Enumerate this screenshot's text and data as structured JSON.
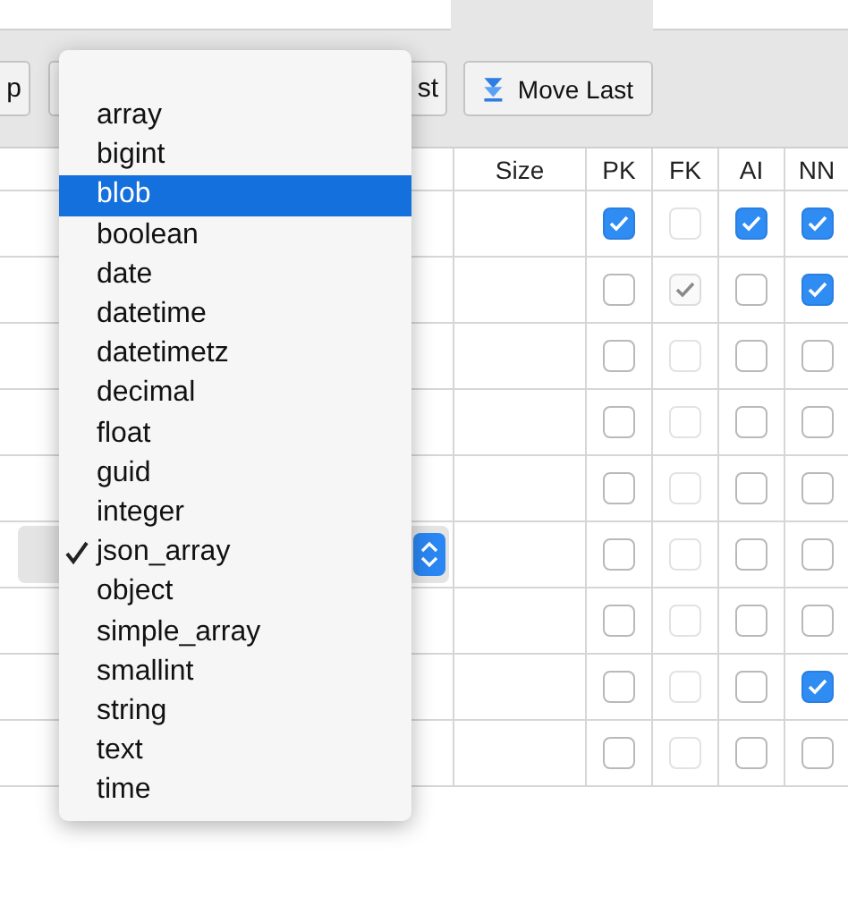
{
  "toolbar": {
    "buttons": [
      {
        "label": "p",
        "kind": "text"
      },
      {
        "label": "st",
        "kind": "text"
      },
      {
        "label": "Move Last",
        "kind": "move-last"
      }
    ]
  },
  "table": {
    "columns": [
      "Size",
      "PK",
      "FK",
      "AI",
      "NN"
    ],
    "rows": [
      {
        "popup_open": false,
        "pk": {
          "checked": true,
          "disabled": false
        },
        "fk": {
          "checked": false,
          "disabled": true
        },
        "ai": {
          "checked": true,
          "disabled": false
        },
        "nn": {
          "checked": true,
          "disabled": false
        }
      },
      {
        "popup_open": false,
        "pk": {
          "checked": false,
          "disabled": false
        },
        "fk": {
          "checked": true,
          "disabled": true
        },
        "ai": {
          "checked": false,
          "disabled": false
        },
        "nn": {
          "checked": true,
          "disabled": false
        }
      },
      {
        "popup_open": false,
        "pk": {
          "checked": false,
          "disabled": false
        },
        "fk": {
          "checked": false,
          "disabled": true
        },
        "ai": {
          "checked": false,
          "disabled": false
        },
        "nn": {
          "checked": false,
          "disabled": false
        }
      },
      {
        "popup_open": false,
        "pk": {
          "checked": false,
          "disabled": false
        },
        "fk": {
          "checked": false,
          "disabled": true
        },
        "ai": {
          "checked": false,
          "disabled": false
        },
        "nn": {
          "checked": false,
          "disabled": false
        }
      },
      {
        "popup_open": false,
        "pk": {
          "checked": false,
          "disabled": false
        },
        "fk": {
          "checked": false,
          "disabled": true
        },
        "ai": {
          "checked": false,
          "disabled": false
        },
        "nn": {
          "checked": false,
          "disabled": false
        }
      },
      {
        "popup_open": true,
        "pk": {
          "checked": false,
          "disabled": false
        },
        "fk": {
          "checked": false,
          "disabled": true
        },
        "ai": {
          "checked": false,
          "disabled": false
        },
        "nn": {
          "checked": false,
          "disabled": false
        }
      },
      {
        "popup_open": false,
        "pk": {
          "checked": false,
          "disabled": false
        },
        "fk": {
          "checked": false,
          "disabled": true
        },
        "ai": {
          "checked": false,
          "disabled": false
        },
        "nn": {
          "checked": false,
          "disabled": false
        }
      },
      {
        "popup_open": false,
        "pk": {
          "checked": false,
          "disabled": false
        },
        "fk": {
          "checked": false,
          "disabled": true
        },
        "ai": {
          "checked": false,
          "disabled": false
        },
        "nn": {
          "checked": true,
          "disabled": false
        }
      },
      {
        "popup_open": false,
        "pk": {
          "checked": false,
          "disabled": false
        },
        "fk": {
          "checked": false,
          "disabled": true
        },
        "ai": {
          "checked": false,
          "disabled": false
        },
        "nn": {
          "checked": false,
          "disabled": false
        }
      }
    ]
  },
  "type_menu": {
    "items": [
      {
        "label": "array",
        "selected": false,
        "checked": false
      },
      {
        "label": "bigint",
        "selected": false,
        "checked": false
      },
      {
        "label": "blob",
        "selected": true,
        "checked": false
      },
      {
        "label": "boolean",
        "selected": false,
        "checked": false
      },
      {
        "label": "date",
        "selected": false,
        "checked": false
      },
      {
        "label": "datetime",
        "selected": false,
        "checked": false
      },
      {
        "label": "datetimetz",
        "selected": false,
        "checked": false
      },
      {
        "label": "decimal",
        "selected": false,
        "checked": false
      },
      {
        "label": "float",
        "selected": false,
        "checked": false
      },
      {
        "label": "guid",
        "selected": false,
        "checked": false
      },
      {
        "label": "integer",
        "selected": false,
        "checked": false
      },
      {
        "label": "json_array",
        "selected": false,
        "checked": true
      },
      {
        "label": "object",
        "selected": false,
        "checked": false
      },
      {
        "label": "simple_array",
        "selected": false,
        "checked": false
      },
      {
        "label": "smallint",
        "selected": false,
        "checked": false
      },
      {
        "label": "string",
        "selected": false,
        "checked": false
      },
      {
        "label": "text",
        "selected": false,
        "checked": false
      },
      {
        "label": "time",
        "selected": false,
        "checked": false
      }
    ]
  }
}
